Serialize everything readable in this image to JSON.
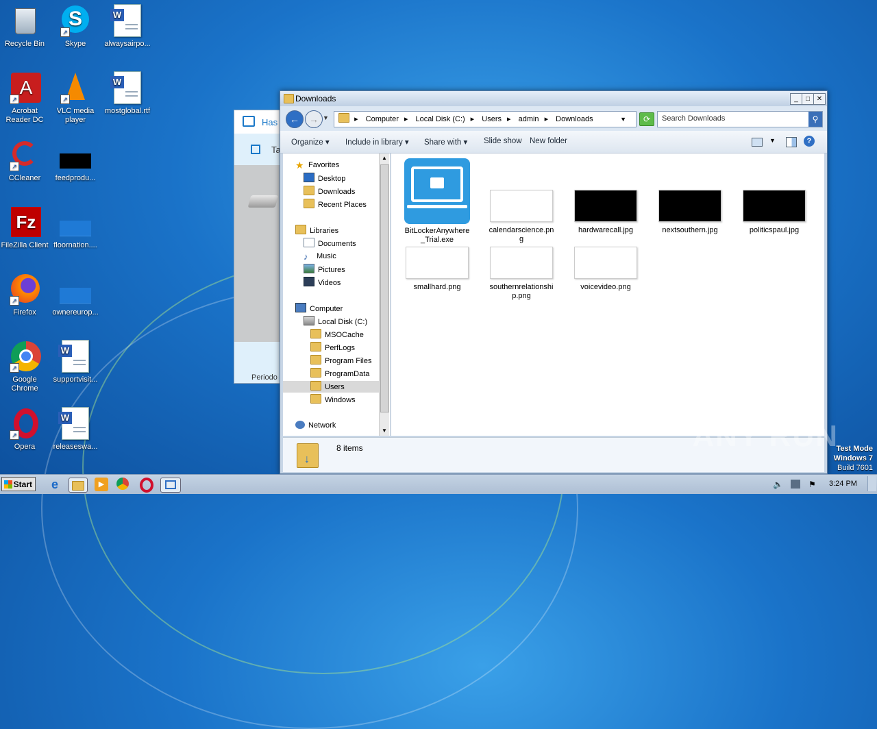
{
  "desktop": {
    "icons": [
      {
        "label": "Recycle Bin"
      },
      {
        "label": "Skype"
      },
      {
        "label": "alwaysairpo..."
      },
      {
        "label": "Acrobat Reader DC"
      },
      {
        "label": "VLC media player"
      },
      {
        "label": "mostglobal.rtf"
      },
      {
        "label": "CCleaner"
      },
      {
        "label": "feedprodu..."
      },
      {
        "label": "FileZilla Client"
      },
      {
        "label": "floornation...."
      },
      {
        "label": "Firefox"
      },
      {
        "label": "ownereurop..."
      },
      {
        "label": "Google Chrome"
      },
      {
        "label": "supportvisit..."
      },
      {
        "label": "Opera"
      },
      {
        "label": "releaseswa..."
      }
    ]
  },
  "bg_dialog": {
    "title_partial": "Has",
    "tab_partial": "Ta",
    "footer_partial": "Periodo"
  },
  "explorer": {
    "title": "Downloads",
    "address": [
      "Computer",
      "Local Disk (C:)",
      "Users",
      "admin",
      "Downloads"
    ],
    "search_placeholder": "Search Downloads",
    "toolbar": {
      "organize": "Organize",
      "include": "Include in library",
      "share": "Share with",
      "slideshow": "Slide show",
      "newfolder": "New folder"
    },
    "nav": {
      "favorites": "Favorites",
      "desktop": "Desktop",
      "downloads": "Downloads",
      "recent": "Recent Places",
      "libraries": "Libraries",
      "documents": "Documents",
      "music": "Music",
      "pictures": "Pictures",
      "videos": "Videos",
      "computer": "Computer",
      "localdisk": "Local Disk (C:)",
      "msocache": "MSOCache",
      "perflogs": "PerfLogs",
      "programfiles": "Program Files",
      "programdata": "ProgramData",
      "users": "Users",
      "windows": "Windows",
      "network": "Network"
    },
    "files": [
      {
        "name": "BitLockerAnywhere_Trial.exe"
      },
      {
        "name": "calendarscience.png"
      },
      {
        "name": "hardwarecall.jpg"
      },
      {
        "name": "nextsouthern.jpg"
      },
      {
        "name": "politicspaul.jpg"
      },
      {
        "name": "smallhard.png"
      },
      {
        "name": "southernrelationship.png"
      },
      {
        "name": "voicevideo.png"
      }
    ],
    "status": "8 items"
  },
  "taskbar": {
    "start": "Start",
    "time": "3:24 PM"
  },
  "watermark": "ANY RUN",
  "testmode": {
    "line1": "Test Mode",
    "line2": "Windows 7",
    "line3": "Build 7601"
  }
}
